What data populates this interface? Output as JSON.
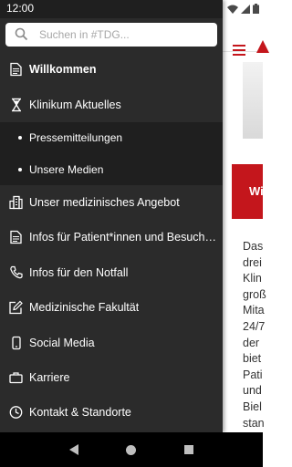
{
  "status_bar": {
    "time": "12:00"
  },
  "search": {
    "placeholder": "Suchen in #TDG..."
  },
  "menu": {
    "items": [
      {
        "label": "Willkommen",
        "icon": "document-icon"
      },
      {
        "label": "Klinikum Aktuelles",
        "icon": "hourglass-icon"
      },
      {
        "label": "Pressemitteilungen"
      },
      {
        "label": "Unsere Medien"
      },
      {
        "label": "Unser medizinisches Angebot",
        "icon": "building-icon"
      },
      {
        "label": "Infos für Patient*innen und Besucher*innen",
        "icon": "document-icon"
      },
      {
        "label": "Infos für den Notfall",
        "icon": "phone-icon"
      },
      {
        "label": "Medizinische Fakultät",
        "icon": "edit-icon"
      },
      {
        "label": "Social Media",
        "icon": "smartphone-icon"
      },
      {
        "label": "Karriere",
        "icon": "briefcase-icon"
      },
      {
        "label": "Kontakt & Standorte",
        "icon": "clock-icon"
      }
    ]
  },
  "background_page": {
    "banner_text": "Wi",
    "body_lines": [
      "Das",
      "drei",
      "Klin",
      "groß",
      "Mita",
      "24/7",
      "der",
      "biet",
      "Pati",
      "und",
      "Biel",
      "stan"
    ]
  },
  "colors": {
    "drawer_bg": "#2b2b2b",
    "submenu_bg": "#1f1f1f",
    "accent": "#c4161c"
  }
}
